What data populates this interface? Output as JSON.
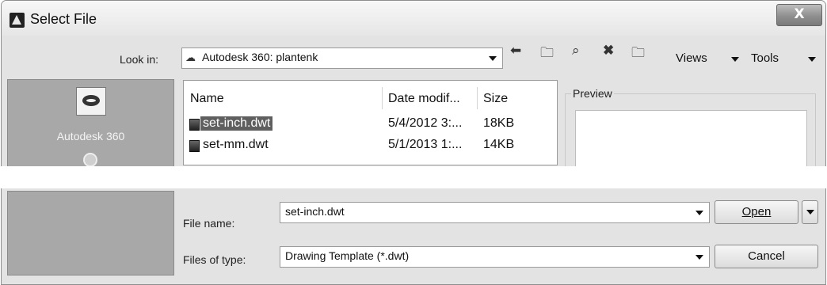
{
  "window": {
    "title": "Select File",
    "close_glyph": "X"
  },
  "toolbar": {
    "look_in_label": "Look in:",
    "look_in_value": "Autodesk 360: plantenk",
    "icons": [
      "back-icon",
      "up-folder-icon",
      "search-web-icon",
      "delete-icon",
      "create-folder-icon"
    ],
    "views_label": "Views",
    "tools_label": "Tools"
  },
  "places": {
    "items": [
      {
        "label": "Autodesk 360",
        "icon": "autodesk-360-icon"
      },
      {
        "label": "",
        "icon": "history-icon"
      }
    ]
  },
  "file_list": {
    "columns": [
      "Name",
      "Date modif...",
      "Size"
    ],
    "rows": [
      {
        "name": "set-inch.dwt",
        "date": "5/4/2012 3:...",
        "size": "18KB",
        "selected": true
      },
      {
        "name": "set-mm.dwt",
        "date": "5/1/2013 1:...",
        "size": "14KB",
        "selected": false
      }
    ]
  },
  "preview": {
    "label": "Preview"
  },
  "footer": {
    "file_name_label": "File name:",
    "file_name_value": "set-inch.dwt",
    "file_type_label": "Files of type:",
    "file_type_value": "Drawing Template (*.dwt)",
    "open_label": "Open",
    "cancel_label": "Cancel"
  },
  "colors": {
    "dialog_bg": "#e3e3e3",
    "places_bg": "#a8a8a8",
    "selection_bg": "#5f5f5f"
  }
}
